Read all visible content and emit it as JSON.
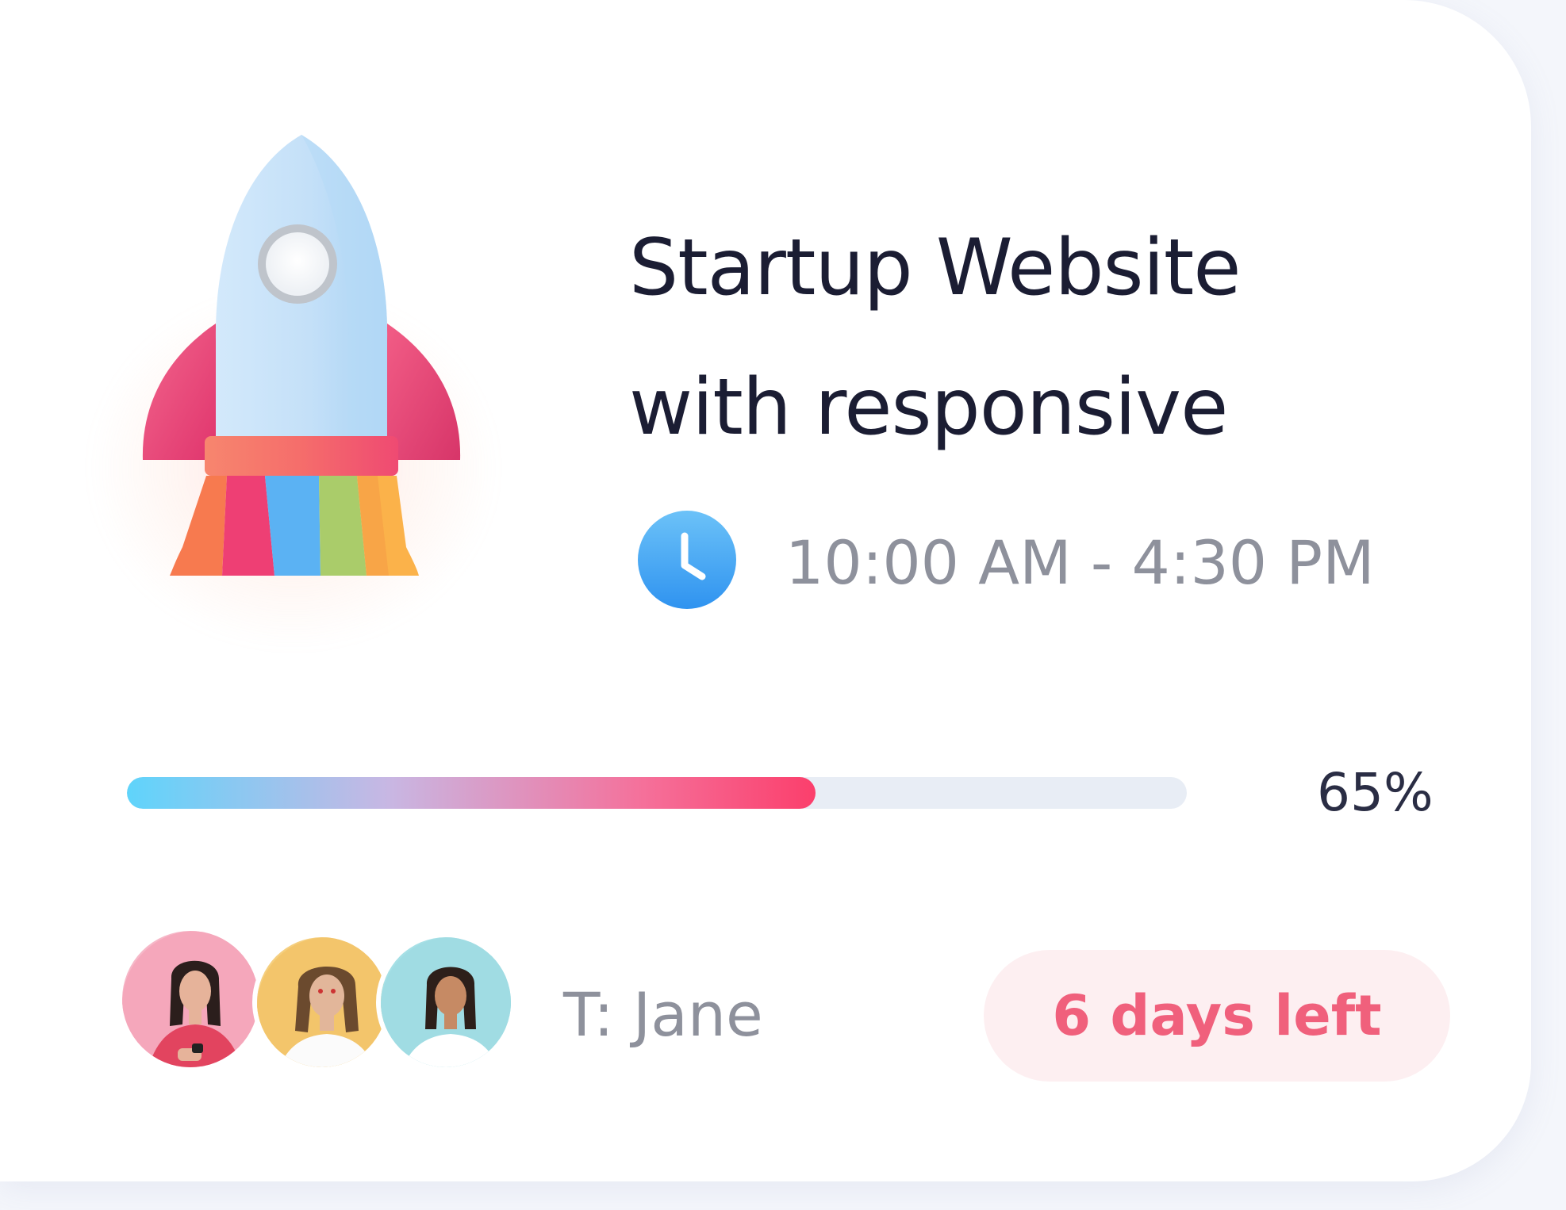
{
  "card": {
    "title_line1": "Startup Website",
    "title_line2": "with responsive",
    "time": "10:00 AM - 4:30 PM",
    "progress": {
      "percent": 65,
      "label": "65%"
    },
    "assignee": "T: Jane",
    "deadline_badge": "6 days left",
    "icons": {
      "illustration": "rocket-icon",
      "time": "clock-icon"
    },
    "colors": {
      "title": "#1b1d33",
      "muted_text": "#8e919c",
      "badge_text": "#f0607c",
      "badge_bg": "#fdeff1",
      "clock": "#4aa8f5",
      "progress_track": "#e8edf5",
      "progress_start": "#5fd4fb",
      "progress_end": "#fb3f6c"
    },
    "avatars": [
      {
        "name": "avatar-1"
      },
      {
        "name": "avatar-2"
      },
      {
        "name": "avatar-3"
      }
    ]
  }
}
